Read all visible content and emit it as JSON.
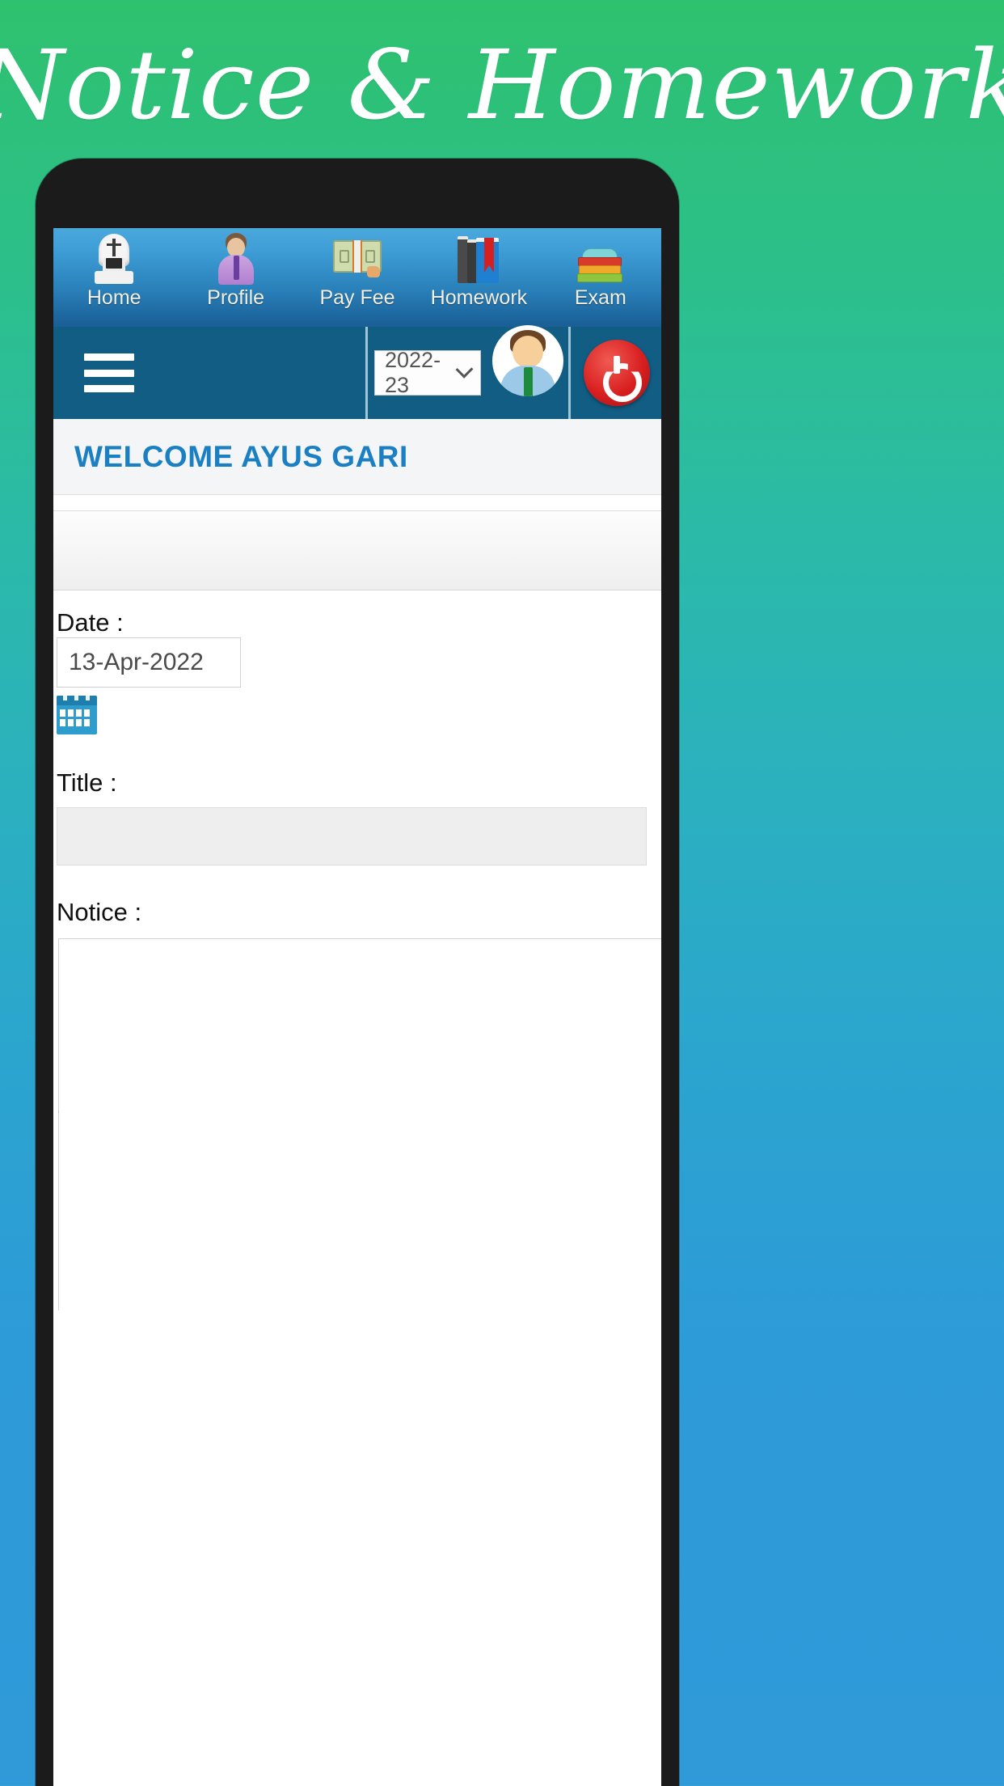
{
  "promo": {
    "title": "Notice & Homework"
  },
  "app": {
    "icon_nav": [
      {
        "label": "Home",
        "icon": "school-crest-icon"
      },
      {
        "label": "Profile",
        "icon": "person-icon"
      },
      {
        "label": "Pay Fee",
        "icon": "money-icon"
      },
      {
        "label": "Homework",
        "icon": "books-icon"
      },
      {
        "label": "Exam",
        "icon": "book-stack-icon"
      }
    ],
    "toolbar": {
      "menu_icon": "hamburger-menu-icon",
      "session_value": "2022-23",
      "session_options": [
        "2022-23"
      ],
      "avatar_icon": "user-avatar-icon",
      "power_icon": "power-logout-icon"
    },
    "welcome": {
      "text": "WELCOME AYUS GARI"
    },
    "form": {
      "date_label": "Date :",
      "date_value": "13-Apr-2022",
      "calendar_icon": "calendar-picker-icon",
      "title_label": "Title :",
      "title_value": "",
      "notice_label": "Notice :",
      "notice_value": ""
    }
  },
  "colors": {
    "banner_green": "#2ec26e",
    "banner_blue": "#309ad9",
    "nav_blue": "#3f9ed6",
    "toolbar_blue": "#115d84",
    "welcome_blue": "#1b7fc4",
    "power_red": "#d81f20"
  }
}
